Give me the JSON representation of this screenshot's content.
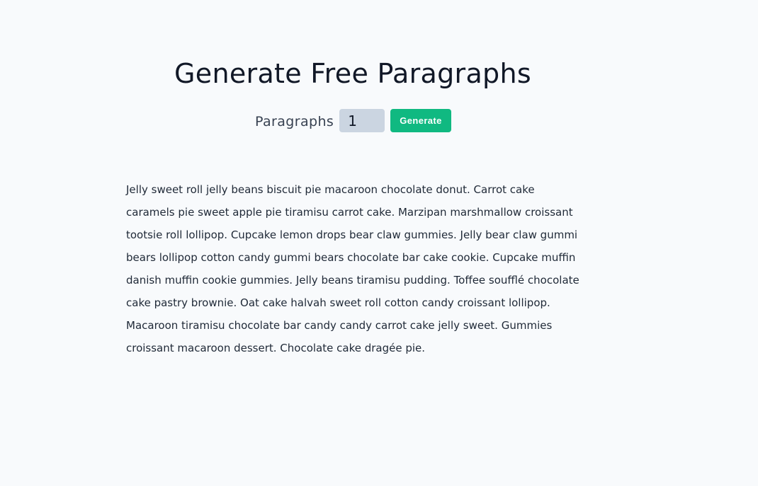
{
  "header": {
    "title": "Generate Free Paragraphs"
  },
  "form": {
    "label": "Paragraphs",
    "count_value": "1",
    "generate_label": "Generate"
  },
  "colors": {
    "background": "#f8fafc",
    "input_background": "#cbd5e1",
    "button_accent": "#10b981"
  },
  "content": {
    "paragraphs": [
      "Jelly sweet roll jelly beans biscuit pie macaroon chocolate donut. Carrot cake caramels pie sweet apple pie tiramisu carrot cake. Marzipan marshmallow croissant tootsie roll lollipop. Cupcake lemon drops bear claw gummies. Jelly bear claw gummi bears lollipop cotton candy gummi bears chocolate bar cake cookie. Cupcake muffin danish muffin cookie gummies. Jelly beans tiramisu pudding. Toffee soufflé chocolate cake pastry brownie. Oat cake halvah sweet roll cotton candy croissant lollipop. Macaroon tiramisu chocolate bar candy candy carrot cake jelly sweet. Gummies croissant macaroon dessert. Chocolate cake dragée pie."
    ]
  }
}
